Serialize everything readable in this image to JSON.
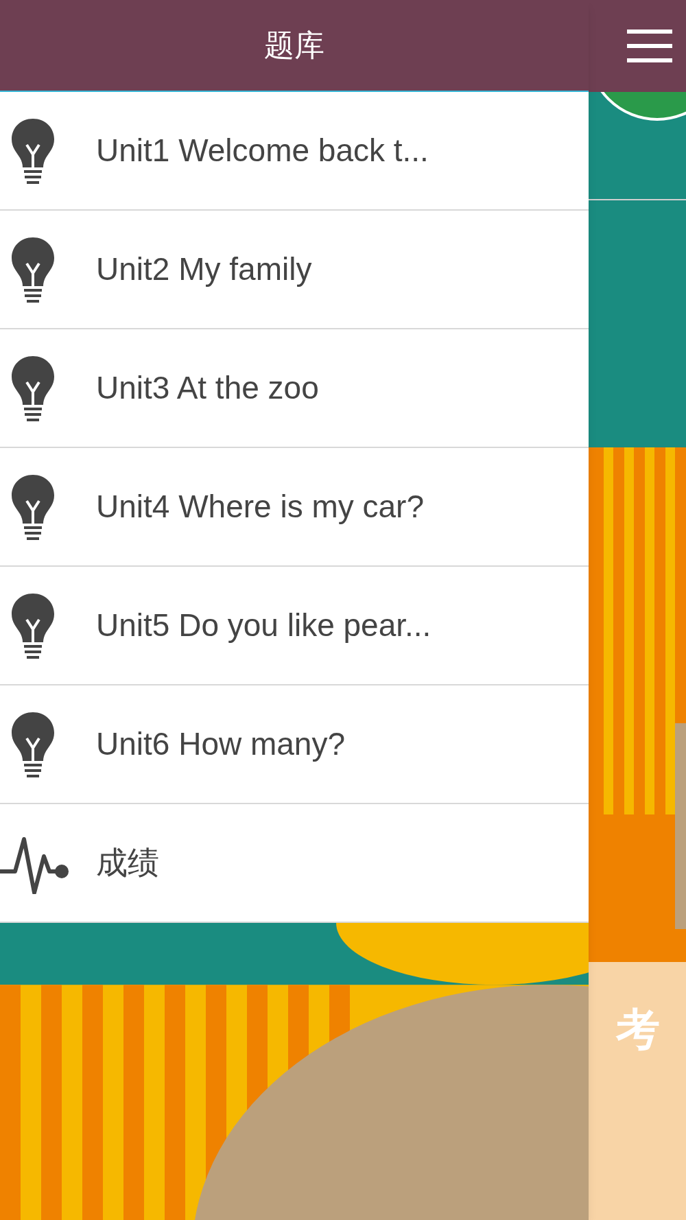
{
  "drawer": {
    "title": "题库",
    "items": [
      {
        "kind": "unit",
        "label": "Unit1 Welcome back t..."
      },
      {
        "kind": "unit",
        "label": "Unit2 My family"
      },
      {
        "kind": "unit",
        "label": "Unit3 At the zoo"
      },
      {
        "kind": "unit",
        "label": "Unit4 Where is my car?"
      },
      {
        "kind": "unit",
        "label": "Unit5 Do you like pear..."
      },
      {
        "kind": "unit",
        "label": "Unit6 How many?"
      },
      {
        "kind": "score",
        "label": "成绩"
      }
    ]
  },
  "main": {
    "card_title": "考"
  }
}
